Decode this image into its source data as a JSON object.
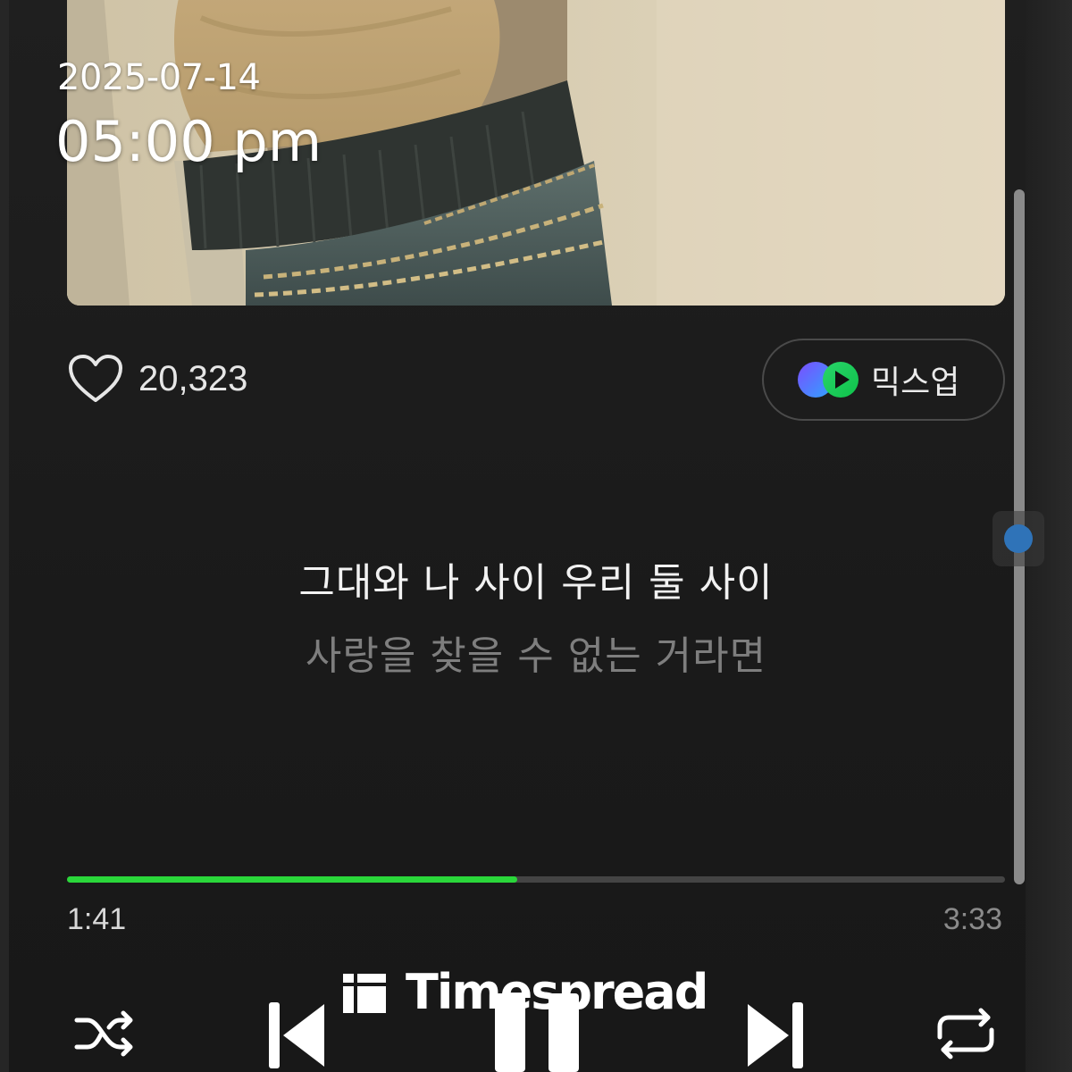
{
  "timestamp": {
    "date": "2025-07-14",
    "time": "05:00 pm"
  },
  "like": {
    "icon": "heart-outline-icon",
    "count": "20,323"
  },
  "mixup": {
    "icon": "mixup-logo-icon",
    "label": "믹스업"
  },
  "lyrics": {
    "current": "그대와 나 사이 우리 둘 사이",
    "next": "사랑을 찾을 수 없는 거라면"
  },
  "progress": {
    "elapsed": "1:41",
    "total": "3:33",
    "fraction": 0.48,
    "fill_color": "#2ad73a"
  },
  "scrollbar": {
    "thumb_color": "#2f73b8"
  },
  "controls": {
    "shuffle": "shuffle-icon",
    "previous": "skip-previous-icon",
    "pause": "pause-icon",
    "next": "skip-next-icon",
    "repeat": "repeat-icon"
  },
  "watermark": {
    "text": "Timespread"
  }
}
